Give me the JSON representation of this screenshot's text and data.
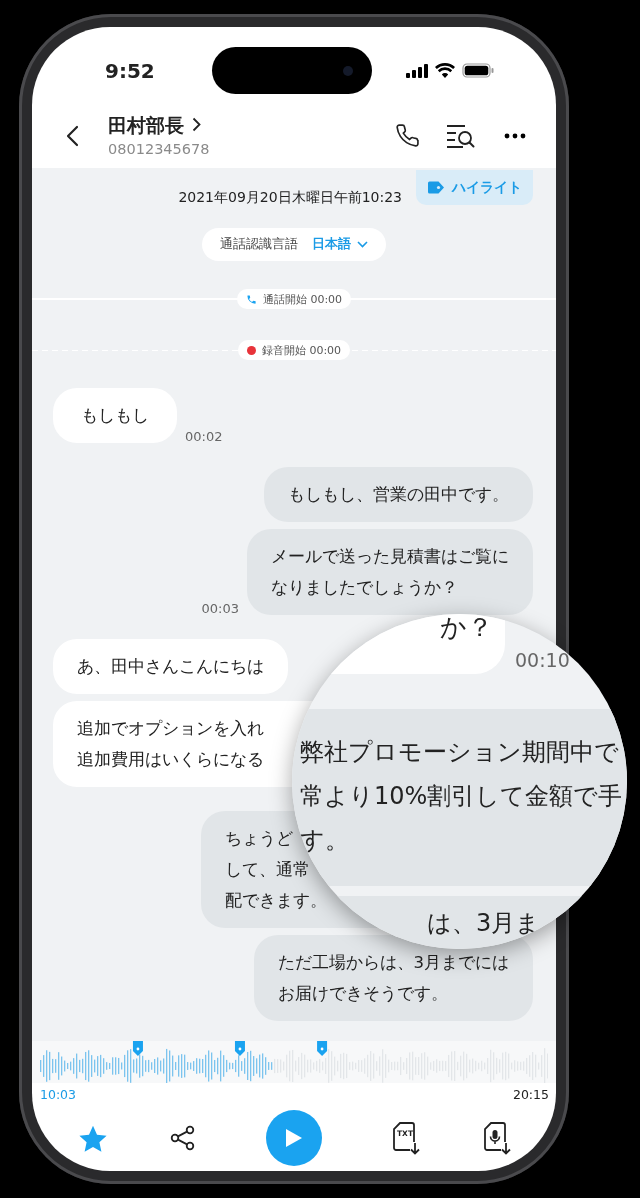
{
  "status_bar": {
    "time": "9:52"
  },
  "header": {
    "contact_name": "田村部長",
    "phone_number": "08012345678"
  },
  "recording_info": {
    "date": "2021年09月20日木曜日午前10:23",
    "highlight_label": "ハイライト"
  },
  "language": {
    "label": "通話認識言語",
    "value": "日本語"
  },
  "events": [
    {
      "kind": "call",
      "text": "通話開始 00:00"
    },
    {
      "kind": "recording",
      "text": "録音開始 00:00"
    }
  ],
  "messages": [
    {
      "outgoing": false,
      "text": "もしもし",
      "time": "00:02"
    },
    {
      "outgoing": true,
      "text": "もしもし、営業の田中です。"
    },
    {
      "outgoing": true,
      "lines": [
        "メールで送った見積書はご覧に",
        "なりましたでしょうか？"
      ],
      "time": "00:03"
    },
    {
      "outgoing": false,
      "text": "あ、田中さんこんにちは"
    },
    {
      "outgoing": false,
      "lines": [
        "追加でオプションを入れ",
        "追加費用はいくらになる"
      ]
    },
    {
      "outgoing": true,
      "lines": [
        "ちょうど",
        "して、通常",
        "配できます。"
      ]
    },
    {
      "outgoing": true,
      "lines": [
        "ただ工場からは、3月までには",
        "お届けできそうです。"
      ]
    }
  ],
  "magnifier": {
    "top_text": "か？",
    "top_time": "00:10",
    "main_lines": [
      "弊社プロモーション期間中で",
      "常より10%割引して金額で手",
      "す。"
    ],
    "bottom_text": "は、3月ま"
  },
  "player": {
    "level": 0.46,
    "current_time": "10:03",
    "total_time": "20:15",
    "starred": true,
    "txt_label": "TXT"
  }
}
